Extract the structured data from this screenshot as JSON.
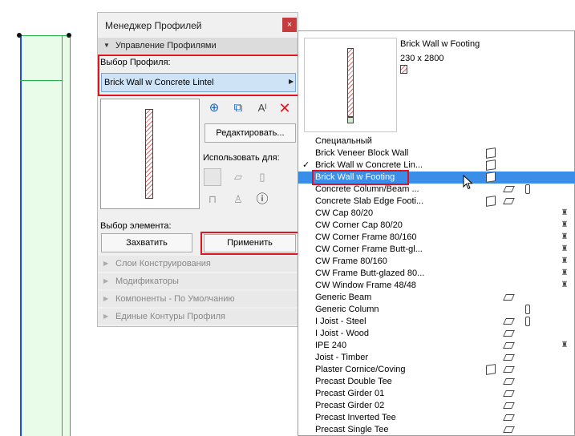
{
  "palette": {
    "title": "Менеджер Профилей",
    "close_icon": "×",
    "section_manage": "Управление Профилями",
    "select_label": "Выбор Профиля:",
    "selected_profile": "Brick Wall w Concrete Lintel",
    "edit_button": "Редактировать...",
    "use_for_label": "Использовать для:",
    "element_label": "Выбор элемента:",
    "capture_button": "Захватить",
    "apply_button": "Применить",
    "collapsed_sections": [
      "Слои Конструирования",
      "Модификаторы",
      "Компоненты - По Умолчанию",
      "Единые Контуры Профиля"
    ],
    "tool_icons": [
      "add-profile-icon",
      "duplicate-profile-icon",
      "rename-profile-icon",
      "delete-profile-icon"
    ],
    "use_for_icons": [
      "wall-use-icon",
      "beam-use-icon",
      "column-use-icon",
      "railing-use-icon",
      "chair-use-icon",
      "info-icon"
    ]
  },
  "popup": {
    "preview_name": "Brick Wall w Footing",
    "preview_size": "230 x 2800",
    "items": [
      {
        "label": "Специальный",
        "icons": []
      },
      {
        "label": "Brick Veneer Block Wall",
        "icons": [
          "wall"
        ]
      },
      {
        "label": "Brick Wall w Concrete Lin...",
        "icons": [
          "wall"
        ],
        "checked": true
      },
      {
        "label": "Brick Wall w Footing",
        "icons": [
          "wall"
        ],
        "selected": true
      },
      {
        "label": "Concrete Column/Beam ...",
        "icons": [
          "beam",
          "col"
        ]
      },
      {
        "label": "Concrete Slab Edge Footi...",
        "icons": [
          "wall",
          "beam"
        ]
      },
      {
        "label": "CW Cap 80/20",
        "icons": [
          "cw"
        ]
      },
      {
        "label": "CW Corner Cap 80/20",
        "icons": [
          "cw"
        ]
      },
      {
        "label": "CW Corner Frame 80/160",
        "icons": [
          "cw"
        ]
      },
      {
        "label": "CW Corner Frame Butt-gl...",
        "icons": [
          "cw"
        ]
      },
      {
        "label": "CW Frame 80/160",
        "icons": [
          "cw"
        ]
      },
      {
        "label": "CW Frame Butt-glazed 80...",
        "icons": [
          "cw"
        ]
      },
      {
        "label": "CW Window Frame 48/48",
        "icons": [
          "cw"
        ]
      },
      {
        "label": "Generic Beam",
        "icons": [
          "beam"
        ]
      },
      {
        "label": "Generic Column",
        "icons": [
          "col"
        ]
      },
      {
        "label": "I Joist - Steel",
        "icons": [
          "beam",
          "col"
        ]
      },
      {
        "label": "I Joist - Wood",
        "icons": [
          "beam"
        ]
      },
      {
        "label": "IPE 240",
        "icons": [
          "beam",
          "cw"
        ]
      },
      {
        "label": "Joist - Timber",
        "icons": [
          "beam"
        ]
      },
      {
        "label": "Plaster Cornice/Coving",
        "icons": [
          "wall",
          "beam"
        ]
      },
      {
        "label": "Precast Double Tee",
        "icons": [
          "beam"
        ]
      },
      {
        "label": "Precast Girder 01",
        "icons": [
          "beam"
        ]
      },
      {
        "label": "Precast Girder 02",
        "icons": [
          "beam"
        ]
      },
      {
        "label": "Precast Inverted Tee",
        "icons": [
          "beam"
        ]
      },
      {
        "label": "Precast Single Tee",
        "icons": [
          "beam"
        ]
      }
    ]
  },
  "colors": {
    "highlight": "#3b8ee8",
    "callout": "#e0141e",
    "wall_fill": "#e9fbe9"
  }
}
